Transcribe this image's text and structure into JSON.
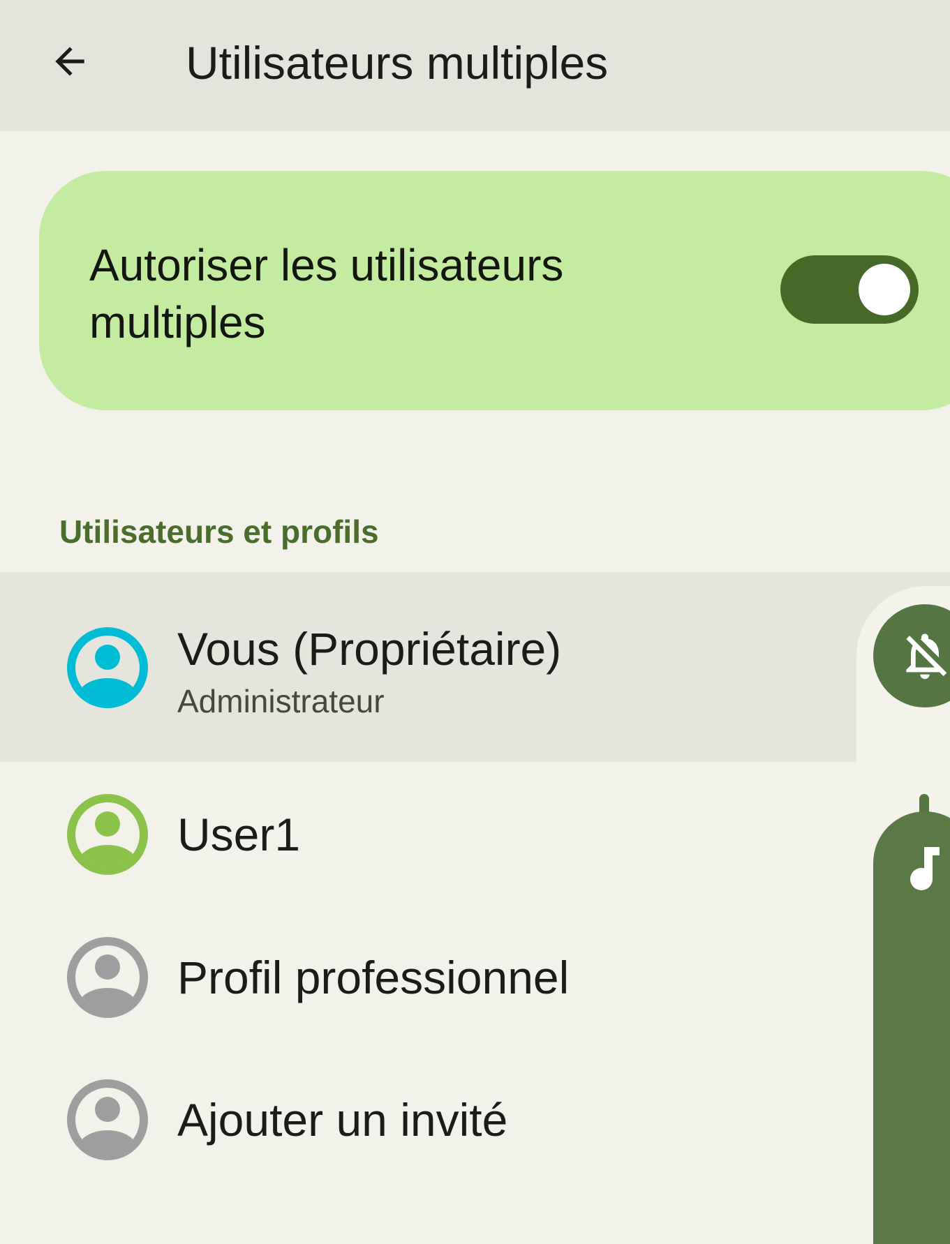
{
  "header": {
    "title": "Utilisateurs multiples",
    "back_icon": "arrow-back-icon"
  },
  "toggle": {
    "label": "Autoriser les utilisateurs multiples",
    "checked": true,
    "accent": "#466928",
    "card_color": "#c3eca0"
  },
  "section": {
    "title": "Utilisateurs et profils",
    "color": "#4a6d2c"
  },
  "users": [
    {
      "name": "Vous (Propriétaire)",
      "subtitle": "Administrateur",
      "avatar_color": "#00bcd4",
      "selected": true
    },
    {
      "name": "User1",
      "subtitle": "",
      "avatar_color": "#8bc34a",
      "selected": false
    },
    {
      "name": "Profil professionnel",
      "subtitle": "",
      "avatar_color": "#9e9e9e",
      "selected": false
    },
    {
      "name": "Ajouter un invité",
      "subtitle": "",
      "avatar_color": "#9e9e9e",
      "selected": false
    }
  ],
  "volume_panel": {
    "ringer_icon": "bell-off-icon",
    "stream_icon": "music-note-icon",
    "color": "#557642"
  }
}
